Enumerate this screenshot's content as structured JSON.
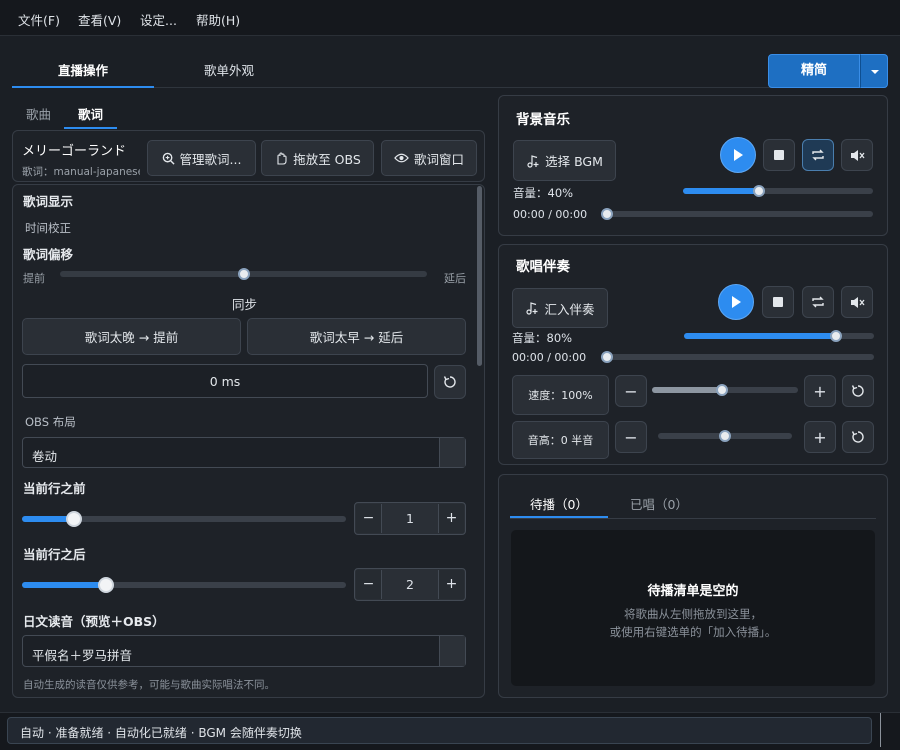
{
  "menu": [
    "文件(F)",
    "查看(V)",
    "设定...",
    "帮助(H)"
  ],
  "tabs": [
    "直播操作",
    "歌单外观"
  ],
  "mode_button": "精简",
  "subtabs": [
    "歌曲",
    "歌词"
  ],
  "song": {
    "title": "メリーゴーランド",
    "subtitle": "歌词：manual-japanese"
  },
  "song_buttons": [
    "管理歌词...",
    "拖放至 OBS",
    "歌词窗口"
  ],
  "lyrics": {
    "section": "歌词显示",
    "calib": "时间校正",
    "offset_title": "歌词偏移",
    "left": "提前",
    "right": "延后",
    "sync": "同步",
    "btn_early": "歌词太晚 → 提前",
    "btn_late": "歌词太早 → 延后",
    "offset_value": "0 ms",
    "obs_layout": "OBS 布局",
    "layout_value": "卷动",
    "before_title": "当前行之前",
    "before_value": "1",
    "after_title": "当前行之后",
    "after_value": "2",
    "reading_title": "日文读音（预览＋OBS）",
    "reading_value": "平假名＋罗马拼音",
    "note": "自动生成的读音仅供参考，可能与歌曲实际唱法不同。",
    "offset_level": 0.5,
    "before_level": 0.16,
    "after_level": 0.26
  },
  "bgm": {
    "title": "背景音乐",
    "select": "选择 BGM",
    "volume": "音量：40%",
    "time": "00:00 / 00:00",
    "volume_level": 0.4
  },
  "karaoke": {
    "title": "歌唱伴奏",
    "import": "汇入伴奏",
    "volume": "音量：80%",
    "time": "00:00 / 00:00",
    "speed": "速度：100%",
    "pitch": "音高：0 半音",
    "volume_level": 0.8,
    "speed_level": 0.48,
    "pitch_level": 0.5
  },
  "queue": {
    "tab_pending": "待播（0）",
    "tab_done": "已唱（0）",
    "empty_title": "待播清单是空的",
    "empty_line1": "将歌曲从左侧拖放到这里，",
    "empty_line2": "或使用右键选单的「加入待播」。"
  },
  "status": "自动 · 准备就绪 · 自动化已就绪 · BGM 会随伴奏切换",
  "colors": {
    "accent": "#2d8cf0",
    "background": "#1b1f25"
  }
}
